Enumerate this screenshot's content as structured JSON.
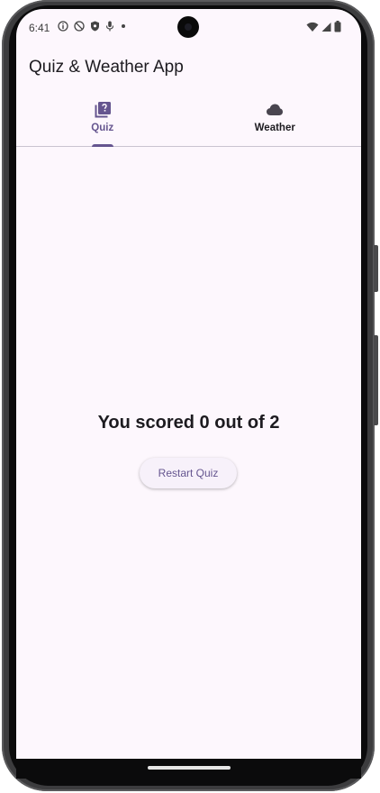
{
  "status_bar": {
    "time": "6:41",
    "left_icons": [
      "info-icon",
      "no-disturb-icon",
      "shield-icon",
      "mic-icon",
      "dot-icon"
    ],
    "right_icons": [
      "wifi-icon",
      "signal-icon",
      "battery-icon"
    ]
  },
  "app_bar": {
    "title": "Quiz & Weather App"
  },
  "tabs": [
    {
      "label": "Quiz",
      "icon": "quiz-icon",
      "selected": true
    },
    {
      "label": "Weather",
      "icon": "cloud-icon",
      "selected": false
    }
  ],
  "quiz_result": {
    "message": "You scored 0 out of 2",
    "restart_label": "Restart Quiz"
  },
  "colors": {
    "background": "#fdf7fd",
    "accent": "#65558f",
    "text": "#1d1b20",
    "divider": "#cac4d0"
  }
}
